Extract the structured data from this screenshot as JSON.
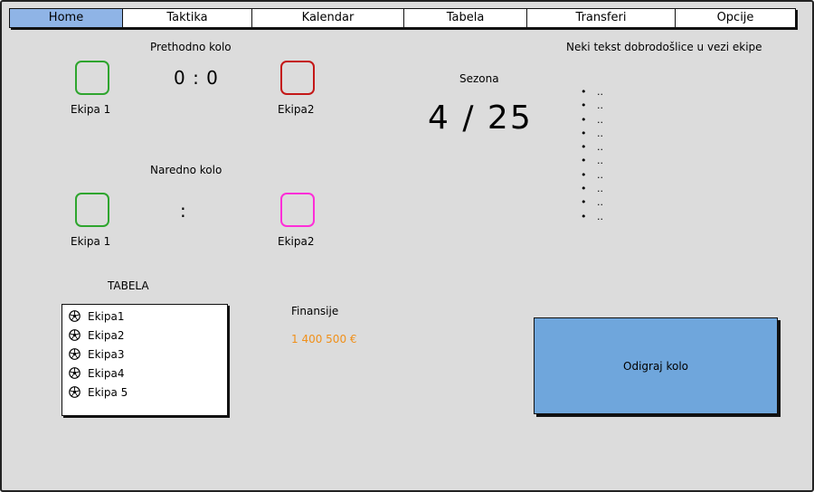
{
  "nav": {
    "tabs": [
      {
        "label": "Home",
        "active": true
      },
      {
        "label": "Taktika"
      },
      {
        "label": "Kalendar"
      },
      {
        "label": "Tabela"
      },
      {
        "label": "Transferi"
      },
      {
        "label": "Opcije"
      }
    ]
  },
  "previous_round": {
    "title": "Prethodno kolo",
    "home_team": "Ekipa 1",
    "away_team": "Ekipa2",
    "score": "0 : 0",
    "home_color": "#2ea52e",
    "away_color": "#c41818"
  },
  "next_round": {
    "title": "Naredno kolo",
    "home_team": "Ekipa 1",
    "away_team": "Ekipa2",
    "score": ":",
    "home_color": "#2ea52e",
    "away_color": "#ff2ed8"
  },
  "season": {
    "label": "Sezona",
    "value": "4 / 25"
  },
  "welcome": {
    "text": "Neki tekst dobrodošlice u vezi ekipe",
    "bullets": [
      "..",
      "..",
      "..",
      "..",
      "..",
      "..",
      "..",
      "..",
      "..",
      ".."
    ]
  },
  "table": {
    "title": "TABELA",
    "teams": [
      "Ekipa1",
      "Ekipa2",
      "Ekipa3",
      "Ekipa4",
      "Ekipa 5"
    ],
    "icon": "soccer-ball-icon"
  },
  "finance": {
    "label": "Finansije",
    "amount": "1 400  500 €",
    "amount_color": "#f0901a"
  },
  "play_button": {
    "label": "Odigraj kolo",
    "color": "#6fa6dc"
  }
}
